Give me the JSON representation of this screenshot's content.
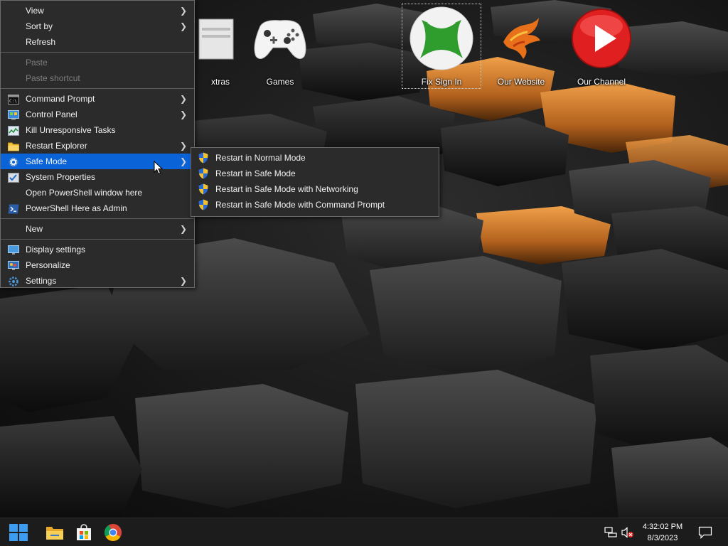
{
  "desktop": {
    "icons": [
      {
        "label": "xtras",
        "icon": "folder-extras-icon"
      },
      {
        "label": "Games",
        "icon": "game-controller-icon"
      },
      {
        "label": "Fix Sign In",
        "icon": "xbox-icon",
        "selected": true
      },
      {
        "label": "Our Website",
        "icon": "phoenix-logo-icon"
      },
      {
        "label": "Our Channel",
        "icon": "play-button-icon"
      }
    ]
  },
  "context_menu": {
    "items": [
      {
        "label": "View",
        "has_submenu": true
      },
      {
        "label": "Sort by",
        "has_submenu": true
      },
      {
        "label": "Refresh"
      },
      {
        "label": "Paste",
        "disabled": true
      },
      {
        "label": "Paste shortcut",
        "disabled": true
      },
      {
        "label": "Command Prompt",
        "icon": "command-prompt-icon",
        "has_submenu": true
      },
      {
        "label": "Control Panel",
        "icon": "control-panel-icon",
        "has_submenu": true
      },
      {
        "label": "Kill Unresponsive Tasks",
        "icon": "task-kill-icon"
      },
      {
        "label": "Restart Explorer",
        "icon": "folder-icon",
        "has_submenu": true
      },
      {
        "label": "Safe Mode",
        "icon": "gear-icon",
        "has_submenu": true,
        "highlighted": true
      },
      {
        "label": "System Properties",
        "icon": "system-properties-icon"
      },
      {
        "label": "Open PowerShell window here"
      },
      {
        "label": "PowerShell Here as Admin",
        "icon": "powershell-icon"
      },
      {
        "label": "New",
        "has_submenu": true
      },
      {
        "label": "Display settings",
        "icon": "display-icon"
      },
      {
        "label": "Personalize",
        "icon": "personalize-icon"
      },
      {
        "label": "Settings",
        "icon": "gear-icon",
        "has_submenu": true
      }
    ]
  },
  "safe_mode_submenu": {
    "items": [
      {
        "label": "Restart in Normal Mode",
        "icon": "uac-shield-icon"
      },
      {
        "label": "Restart in Safe Mode",
        "icon": "uac-shield-icon"
      },
      {
        "label": "Restart in Safe Mode with Networking",
        "icon": "uac-shield-icon"
      },
      {
        "label": "Restart in Safe Mode with Command Prompt",
        "icon": "uac-shield-icon"
      }
    ]
  },
  "taskbar": {
    "pinned": [
      "windows-start-icon",
      "file-explorer-icon",
      "microsoft-store-icon",
      "chrome-icon"
    ],
    "tray": {
      "network_icon": "network-icon",
      "volume_icon": "volume-muted-icon",
      "time": "4:32:02 PM",
      "date": "8/3/2023",
      "notifications_icon": "action-center-icon"
    }
  },
  "colors": {
    "menu_bg": "#2b2b2b",
    "highlight": "#0a64d8",
    "taskbar_bg": "#1c1c1c",
    "accent_orange": "#e08a2c"
  }
}
